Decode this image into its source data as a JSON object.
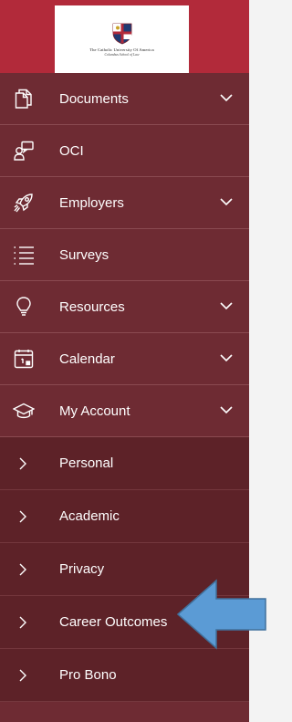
{
  "logo": {
    "line1": "The Catholic University Of America",
    "line2": "Columbus School of Law",
    "icon": "university-crest"
  },
  "sidebar": {
    "items": [
      {
        "label": "Documents",
        "icon": "documents-icon",
        "expandable": true
      },
      {
        "label": "OCI",
        "icon": "oci-icon",
        "expandable": false
      },
      {
        "label": "Employers",
        "icon": "rocket-icon",
        "expandable": true
      },
      {
        "label": "Surveys",
        "icon": "checklist-icon",
        "expandable": false
      },
      {
        "label": "Resources",
        "icon": "lightbulb-icon",
        "expandable": true
      },
      {
        "label": "Calendar",
        "icon": "calendar-icon",
        "expandable": true
      },
      {
        "label": "My Account",
        "icon": "graduation-cap-icon",
        "expandable": true,
        "expanded": true
      }
    ],
    "subitems": [
      {
        "label": "Personal"
      },
      {
        "label": "Academic"
      },
      {
        "label": "Privacy"
      },
      {
        "label": "Career Outcomes"
      },
      {
        "label": "Pro Bono"
      }
    ]
  },
  "annotation": {
    "type": "arrow",
    "color": "#5b9bd5",
    "points_to": "Career Outcomes"
  },
  "colors": {
    "header": "#b22a3a",
    "sidebar": "#6e2b33",
    "submenu": "#5d2228",
    "arrow": "#5b9bd5"
  }
}
